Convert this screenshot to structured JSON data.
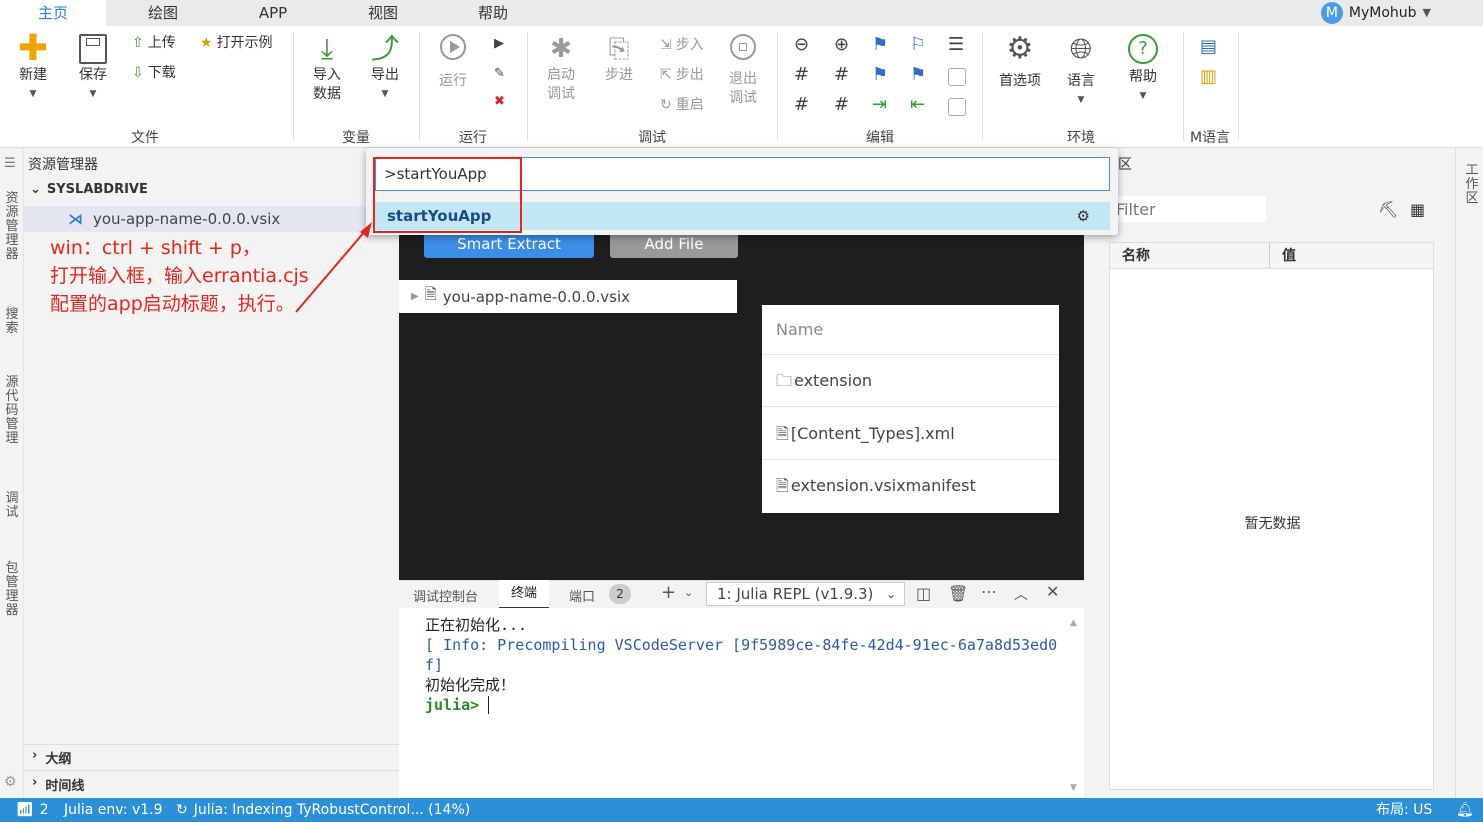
{
  "menubar": {
    "tabs": [
      "主页",
      "绘图",
      "APP",
      "视图",
      "帮助"
    ],
    "user": "MyMohub",
    "avatar": "M"
  },
  "ribbon": {
    "new": "新建",
    "save": "保存",
    "upload": "上传",
    "download": "下载",
    "open_example": "打开示例",
    "file_group": "文件",
    "import1": "导入",
    "import2": "数据",
    "export": "导出",
    "var_group": "变量",
    "run": "运行",
    "run_group": "运行",
    "start_debug1": "启动",
    "start_debug2": "调试",
    "step": "步进",
    "step_in": "步入",
    "step_over": "步出",
    "restart": "重启",
    "exit_debug1": "退出",
    "exit_debug2": "调试",
    "debug_group": "调试",
    "edit_group": "编辑",
    "prefs": "首选项",
    "lang": "语言",
    "help": "帮助",
    "env_group": "环境",
    "mlang_group": "M语言"
  },
  "leftbar": {
    "explorer": "资源管理器",
    "search": "搜索",
    "scm": "源代码管理",
    "debug": "调试",
    "pkg": "包管理器"
  },
  "explorer": {
    "title": "资源管理器",
    "root": "SYSLABDRIVE",
    "file": "you-app-name-0.0.0.vsix",
    "outline": "大纲",
    "timeline": "时间线"
  },
  "annotation": {
    "line1": "win：ctrl + shift + p，",
    "line2": "打开输入框，输入errantia.cjs",
    "line3": "配置的app启动标题，执行。"
  },
  "palette": {
    "input": ">startYouApp",
    "item": "startYouApp"
  },
  "editor": {
    "smart_extract": "Smart Extract",
    "add_file": "Add File",
    "tree_file": "you-app-name-0.0.0.vsix",
    "table_header": "Name",
    "rows": [
      "extension",
      "[Content_Types].xml",
      "extension.vsixmanifest"
    ]
  },
  "panel": {
    "tabs": [
      "调试控制台",
      "终端",
      "端口"
    ],
    "ports_count": "2",
    "terminal_select": "1: Julia REPL (v1.9.3)",
    "lines": [
      "正在初始化...",
      "[ Info: Precompiling VSCodeServer [9f5989ce-84fe-42d4-91ec-6a7a8d53ed0",
      "f]",
      "初始化完成！"
    ],
    "info_tag": "Info:",
    "prompt": "julia>"
  },
  "rightpane": {
    "title_frag": "区",
    "filter_placeholder": "Filter",
    "col_name": "名称",
    "col_value": "值",
    "empty": "暂无数据"
  },
  "rightbar": {
    "label": "工作区"
  },
  "statusbar": {
    "remote": "2",
    "env": "Julia env: v1.9",
    "indexing": "Julia: Indexing TyRobustControl... (14%)",
    "layout": "布局: US"
  }
}
